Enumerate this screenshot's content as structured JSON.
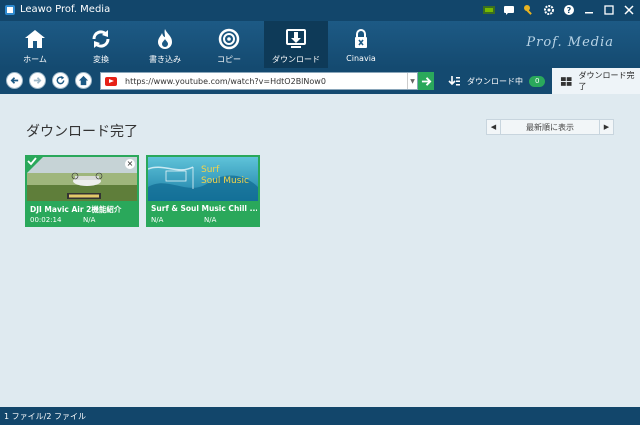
{
  "window": {
    "title": "Leawo Prof. Media",
    "controls": [
      "nvidia-icon",
      "chat-icon",
      "key-icon",
      "gear-icon",
      "help-icon",
      "minimize-icon",
      "maximize-icon",
      "close-icon"
    ]
  },
  "nav": {
    "items": [
      {
        "label": "ホーム",
        "icon": "home-icon"
      },
      {
        "label": "変換",
        "icon": "convert-icon"
      },
      {
        "label": "書き込み",
        "icon": "burn-icon"
      },
      {
        "label": "コピー",
        "icon": "disc-copy-icon"
      },
      {
        "label": "ダウンロード",
        "icon": "download-icon",
        "active": true
      },
      {
        "label": "Cinavia",
        "icon": "cinavia-icon"
      }
    ],
    "brand": "Prof. Media"
  },
  "toolbar": {
    "url": "https://www.youtube.com/watch?v=HdtO2BlNow0",
    "downloading_label": "ダウンロード中",
    "downloading_count": "0",
    "completed_label": "ダウンロード完了"
  },
  "content": {
    "title": "ダウンロード完了",
    "sort_label": "最新順に表示",
    "cards": [
      {
        "name": "DJI Mavic Air 2機能紹介",
        "duration": "00:02:14",
        "size": "N/A",
        "selected": true
      },
      {
        "name": "Surf & Soul Music Chill ...",
        "duration": "N/A",
        "size": "N/A",
        "selected": false,
        "thumb_text_1": "Surf",
        "thumb_text_2": "Soul Music"
      }
    ]
  },
  "status": {
    "text": "1 ファイル/2 ファイル"
  },
  "colors": {
    "titlebar": "#12466b",
    "nav_bg": "#1d5a85",
    "accent_green": "#2aa85b",
    "content_bg": "#dfeaf0"
  }
}
